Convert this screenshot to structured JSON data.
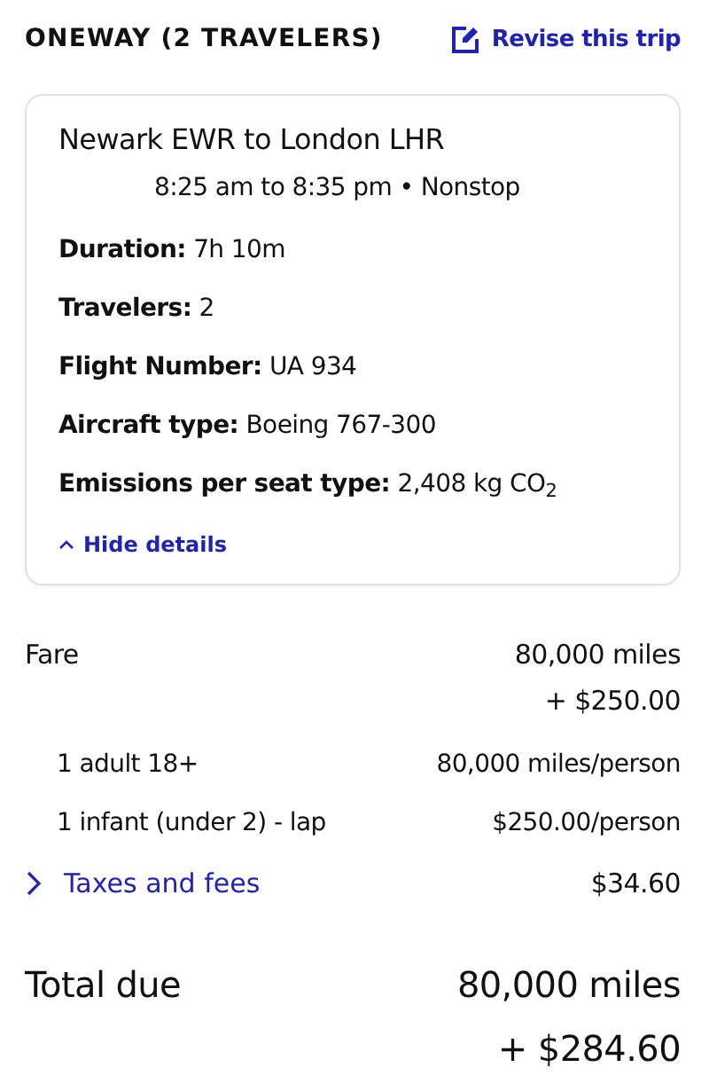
{
  "header": {
    "title": "ONEWAY (2 TRAVELERS)",
    "revise_link": "Revise this trip"
  },
  "flight": {
    "route": "Newark EWR to London LHR",
    "times": "8:25 am to 8:35 pm • Nonstop",
    "details": [
      {
        "label": "Duration:",
        "value": "7h 10m"
      },
      {
        "label": "Travelers:",
        "value": "2"
      },
      {
        "label": "Flight Number:",
        "value": "UA 934"
      },
      {
        "label": "Aircraft type:",
        "value": "Boeing 767-300"
      },
      {
        "label": "Emissions per seat type:",
        "value": "2,408 kg CO$_{2}$"
      }
    ],
    "details_toggle": {
      "label": "Hide details",
      "expanded": true
    }
  },
  "fare": {
    "label": "Fare",
    "lines": [
      "80,000 miles",
      "+ $250.00"
    ],
    "items": [
      {
        "label": "1 adult 18+",
        "value": "80,000 miles/person"
      },
      {
        "label": "1 infant (under 2) - lap",
        "value": "$250.00/person"
      }
    ]
  },
  "taxes": {
    "label": "Taxes and fees",
    "value": "$34.60",
    "expanded": false
  },
  "total": {
    "label": "Total due",
    "lines": [
      "80,000 miles",
      "+ $284.60"
    ]
  }
}
